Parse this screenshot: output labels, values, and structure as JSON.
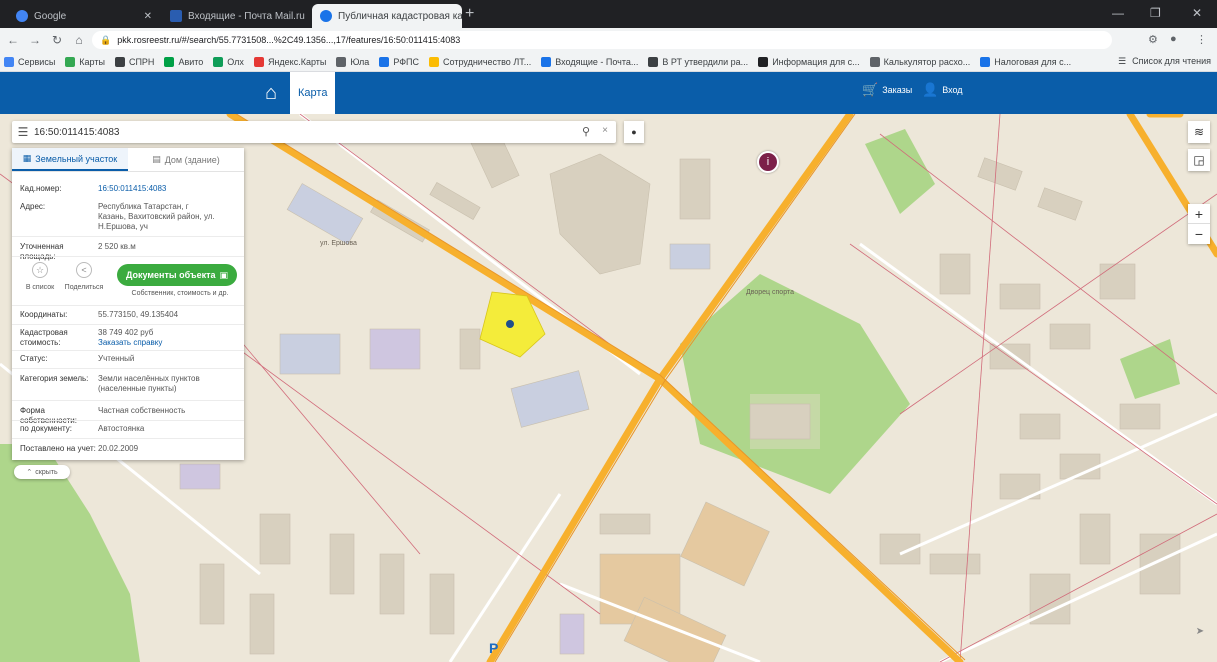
{
  "browser": {
    "tabs": [
      {
        "title": "Google",
        "color": "#4285f4"
      },
      {
        "title": "Входящие - Почта Mail.ru",
        "color": "#2a5db0"
      },
      {
        "title": "Публичная кадастровая карта",
        "color": "#1a73e8"
      }
    ],
    "new_tab": "+",
    "url": "pkk.rosreestr.ru/#/search/55.7731508...%2C49.1356...,17/features/16:50:011415:4083",
    "bookmarks": [
      "Сервисы",
      "Карты",
      "СПРН",
      "Авито",
      "Олх",
      "Яндекс.Карты",
      "Юла",
      "РФПС",
      "Сотрудничество ЛТ...",
      "Входящие - Почта...",
      "В РТ утвердили ра...",
      "Информация для с...",
      "Калькулятор расхо...",
      "Налоговая для с..."
    ],
    "bookmarks_right": "Список для чтения"
  },
  "header": {
    "map_tab": "Карта",
    "cart": "Заказы",
    "login": "Вход"
  },
  "search": {
    "value": "16:50:011415:4083",
    "clear": "×"
  },
  "panel": {
    "tab_land": "Земельный участок",
    "tab_building": "Дом (здание)",
    "rows_top": [
      {
        "k": "Кад.номер:",
        "v": "16:50:011415:4083",
        "link": true
      },
      {
        "k": "Адрес:",
        "v": "Республика Татарстан, г Казань, Вахитовский район, ул. Н.Ершова, уч",
        "link": false
      },
      {
        "k": "Уточненная площадь:",
        "v": "2 520 кв.м",
        "link": false
      }
    ],
    "actions": {
      "share": "В список",
      "export": "Поделиться"
    },
    "order_button": "Документы объекта",
    "order_sub": "Собственник, стоимость и др.",
    "rows_bottom": [
      {
        "k": "Координаты:",
        "v": "55.773150, 49.135404",
        "link": false
      },
      {
        "k": "Кадастровая стоимость:",
        "v": "38 749 402 руб",
        "v2": "Заказать справку",
        "link": false
      },
      {
        "k": "Статус:",
        "v": "Учтенный",
        "link": false
      },
      {
        "k": "Категория земель:",
        "v": "Земли населённых пунктов (населенные пункты)",
        "link": false
      },
      {
        "k": "Форма собственности:",
        "v": "Частная собственность",
        "link": false
      },
      {
        "k": "по документу:",
        "v": "Автостоянка",
        "link": false
      },
      {
        "k": "Поставлено на учет:",
        "v": "20.02.2009",
        "link": false
      }
    ],
    "collapse": "скрыть"
  },
  "map": {
    "poi_label": "Дворец спорта",
    "zoom_in": "+",
    "zoom_out": "−",
    "labels": [
      "ул. Ершова"
    ],
    "colors": {
      "background": "#ede7d9",
      "building": "#d8d0bf",
      "major_road": "#f7b02d",
      "border": "#d16b7a",
      "park": "#aed68b",
      "selected_parcel": "#f4ec3a",
      "header": "#0a5da9",
      "order_button": "#3bab3f"
    }
  }
}
